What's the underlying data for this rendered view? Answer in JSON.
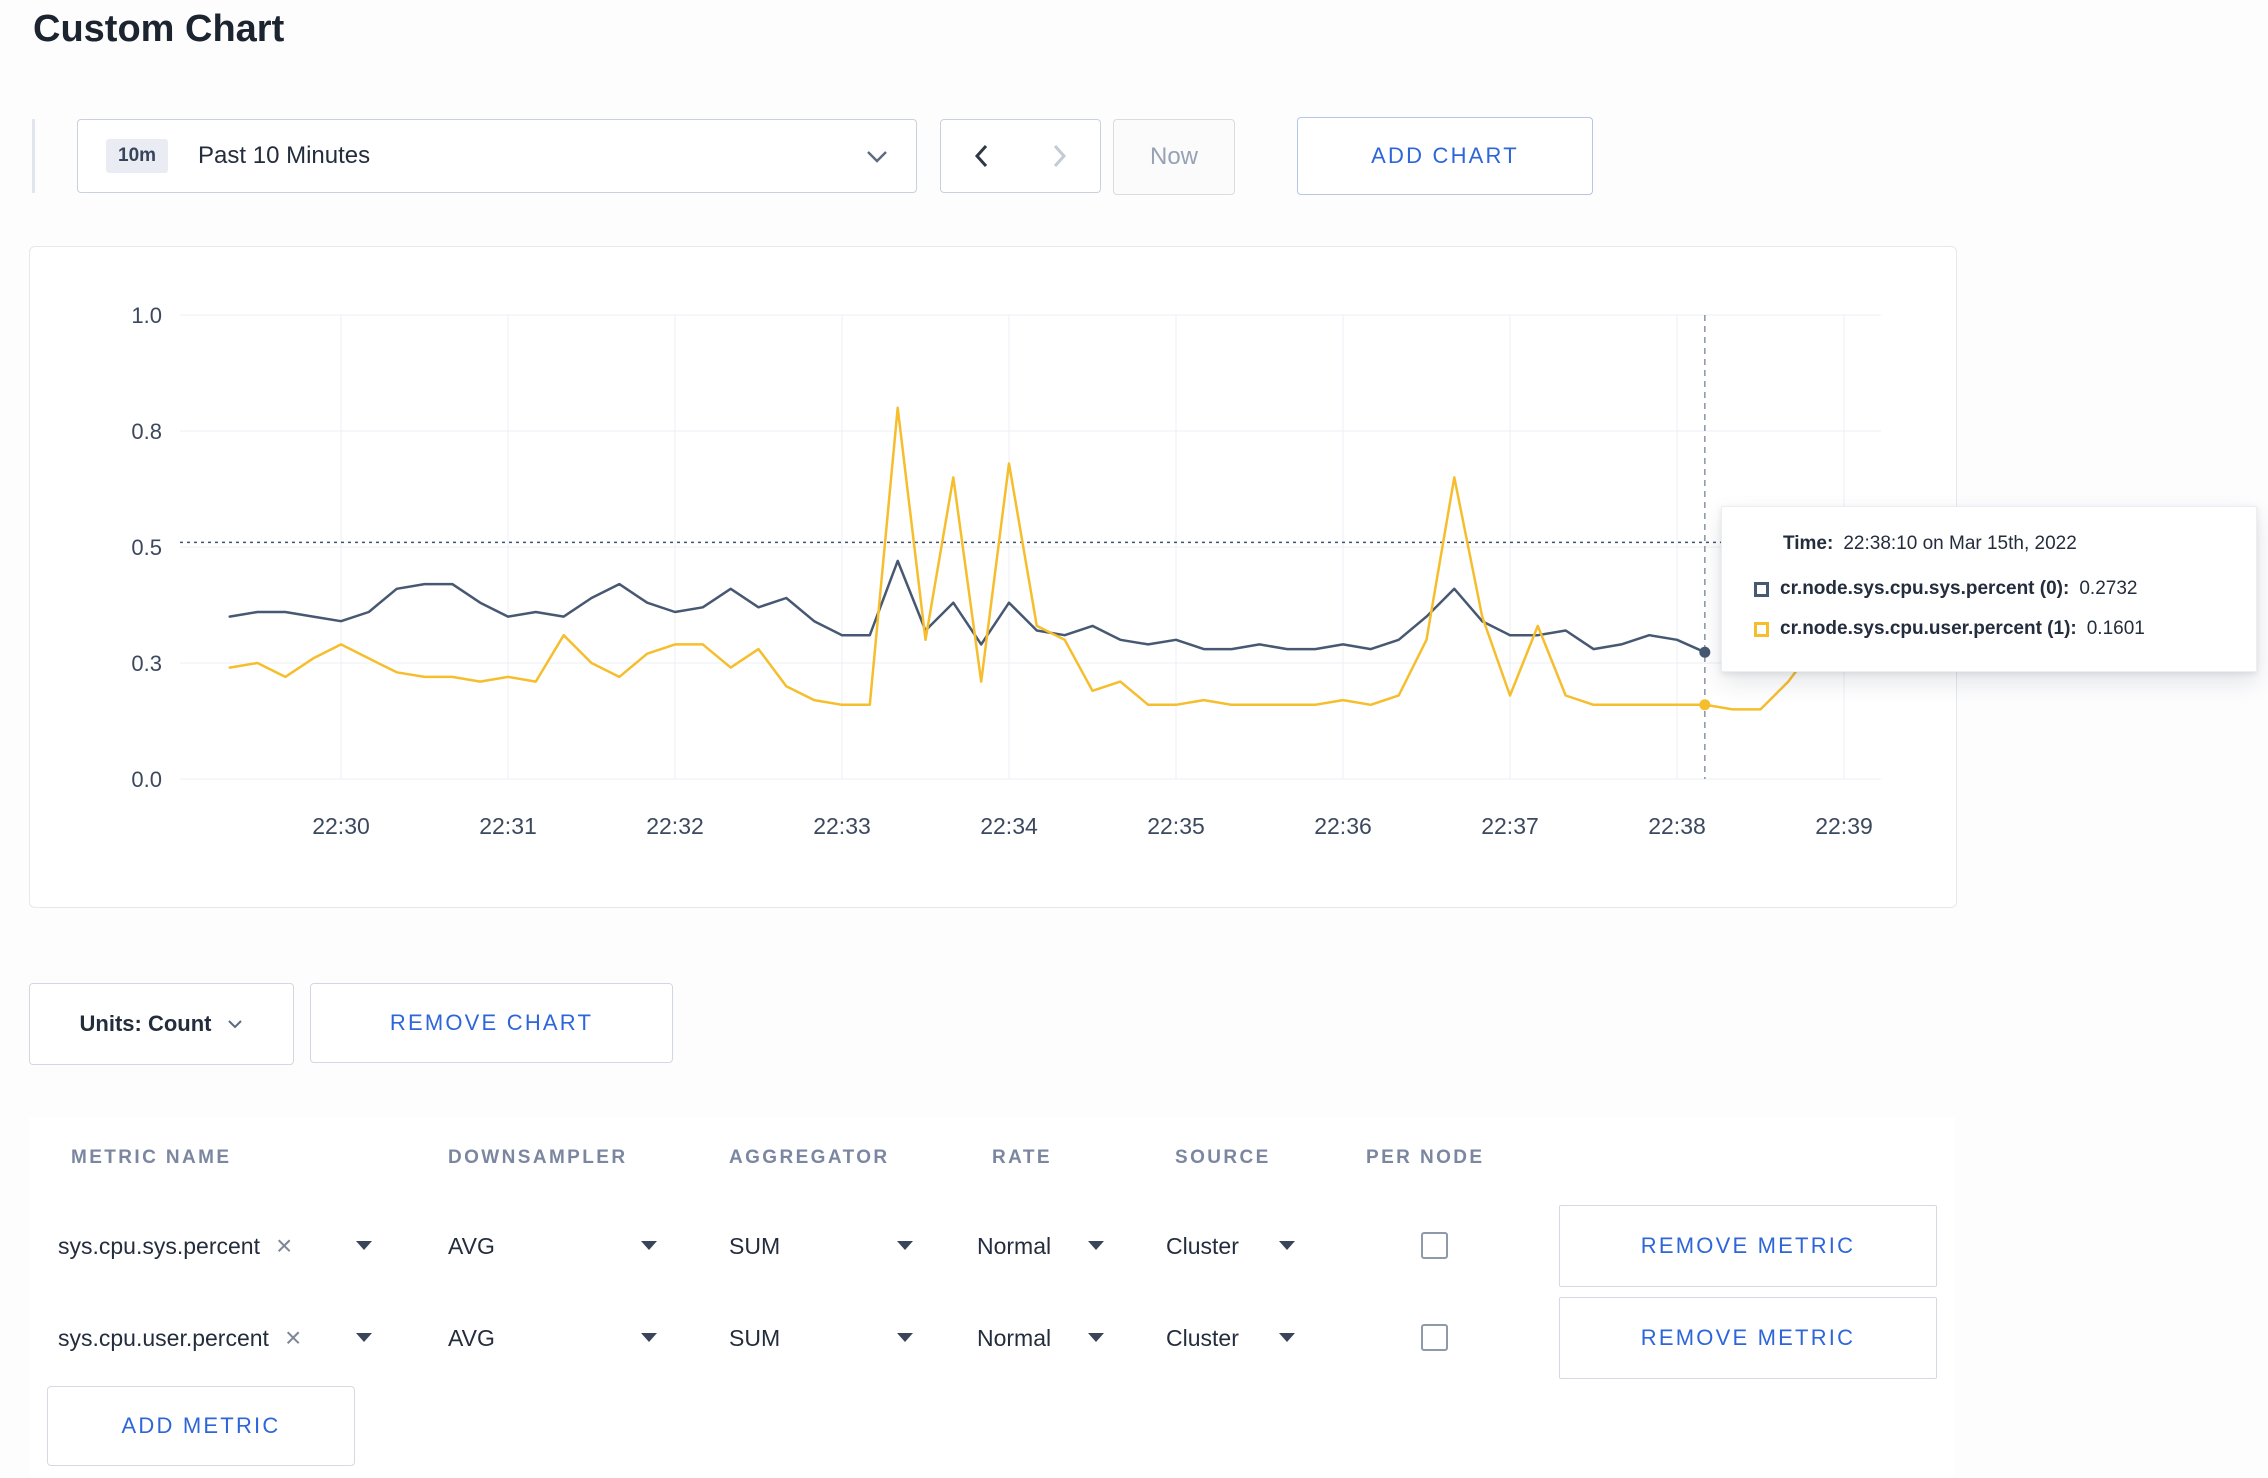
{
  "page": {
    "title": "Custom Chart"
  },
  "toolbar": {
    "range_badge": "10m",
    "range_label": "Past 10 Minutes",
    "now_label": "Now",
    "add_chart_label": "ADD CHART"
  },
  "chart_data": {
    "type": "line",
    "x_start_seconds": 20,
    "x_step_seconds": 10,
    "ylim": [
      0,
      1
    ],
    "grid": true,
    "xticks": [
      {
        "t": 60,
        "label": "22:30"
      },
      {
        "t": 120,
        "label": "22:31"
      },
      {
        "t": 180,
        "label": "22:32"
      },
      {
        "t": 240,
        "label": "22:33"
      },
      {
        "t": 300,
        "label": "22:34"
      },
      {
        "t": 360,
        "label": "22:35"
      },
      {
        "t": 420,
        "label": "22:36"
      },
      {
        "t": 480,
        "label": "22:37"
      },
      {
        "t": 540,
        "label": "22:38"
      },
      {
        "t": 600,
        "label": "22:39"
      }
    ],
    "yticks": [
      {
        "v": 0,
        "label": "0.0"
      },
      {
        "v": 0.25,
        "label": "0.3"
      },
      {
        "v": 0.5,
        "label": "0.5"
      },
      {
        "v": 0.75,
        "label": "0.8"
      },
      {
        "v": 1.0,
        "label": "1.0"
      }
    ],
    "series": [
      {
        "name": "cr.node.sys.cpu.sys.percent",
        "color": "#475872",
        "values": [
          0.35,
          0.36,
          0.36,
          0.35,
          0.34,
          0.36,
          0.41,
          0.42,
          0.42,
          0.38,
          0.35,
          0.36,
          0.35,
          0.39,
          0.42,
          0.38,
          0.36,
          0.37,
          0.41,
          0.37,
          0.39,
          0.34,
          0.31,
          0.31,
          0.47,
          0.32,
          0.38,
          0.29,
          0.38,
          0.32,
          0.31,
          0.33,
          0.3,
          0.29,
          0.3,
          0.28,
          0.28,
          0.29,
          0.28,
          0.28,
          0.29,
          0.28,
          0.3,
          0.35,
          0.41,
          0.34,
          0.31,
          0.31,
          0.32,
          0.28,
          0.29,
          0.31,
          0.3,
          0.2732
        ]
      },
      {
        "name": "cr.node.sys.cpu.user.percent",
        "color": "#f6be2d",
        "values": [
          0.24,
          0.25,
          0.22,
          0.26,
          0.29,
          0.26,
          0.23,
          0.22,
          0.22,
          0.21,
          0.22,
          0.21,
          0.31,
          0.25,
          0.22,
          0.27,
          0.29,
          0.29,
          0.24,
          0.28,
          0.2,
          0.17,
          0.16,
          0.16,
          0.8,
          0.3,
          0.65,
          0.21,
          0.68,
          0.33,
          0.3,
          0.19,
          0.21,
          0.16,
          0.16,
          0.17,
          0.16,
          0.16,
          0.16,
          0.16,
          0.17,
          0.16,
          0.18,
          0.3,
          0.65,
          0.35,
          0.18,
          0.33,
          0.18,
          0.16,
          0.16,
          0.16,
          0.16,
          0.1601,
          0.15,
          0.15,
          0.21,
          0.29,
          0.24
        ]
      }
    ],
    "crosshair": {
      "t": 550,
      "hline_value": 0.51
    },
    "tooltip": {
      "time_label": "Time:",
      "time_value": "22:38:10 on Mar 15th, 2022",
      "rows": [
        {
          "name": "cr.node.sys.cpu.sys.percent (0):",
          "value": "0.2732",
          "color": "#475872"
        },
        {
          "name": "cr.node.sys.cpu.user.percent (1):",
          "value": "0.1601",
          "color": "#f6be2d"
        }
      ]
    }
  },
  "chart_controls": {
    "units_label": "Units: Count",
    "remove_chart_label": "REMOVE CHART"
  },
  "metrics_table": {
    "headers": [
      "METRIC NAME",
      "DOWNSAMPLER",
      "AGGREGATOR",
      "RATE",
      "SOURCE",
      "PER NODE"
    ],
    "rows": [
      {
        "metric": "sys.cpu.sys.percent",
        "downsampler": "AVG",
        "aggregator": "SUM",
        "rate": "Normal",
        "source": "Cluster",
        "per_node": false,
        "remove_label": "REMOVE METRIC"
      },
      {
        "metric": "sys.cpu.user.percent",
        "downsampler": "AVG",
        "aggregator": "SUM",
        "rate": "Normal",
        "source": "Cluster",
        "per_node": false,
        "remove_label": "REMOVE METRIC"
      }
    ],
    "add_metric_label": "ADD METRIC"
  }
}
